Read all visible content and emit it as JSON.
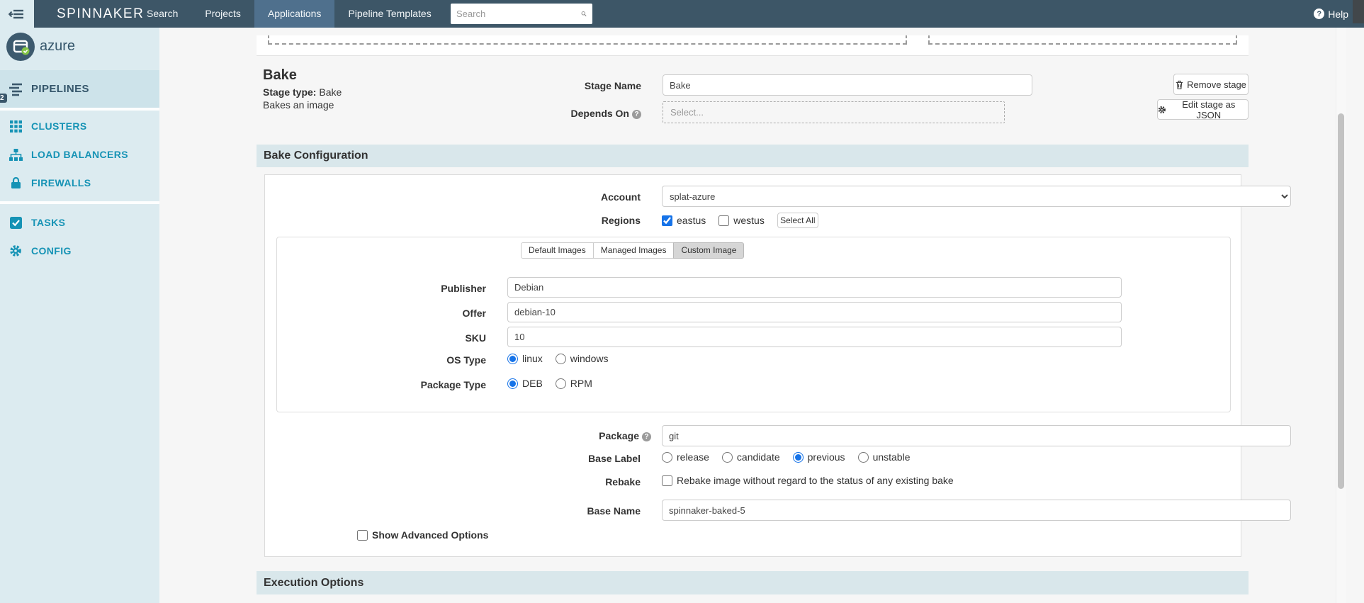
{
  "navbar": {
    "logo": "SPINNAKER",
    "search_item": "Search",
    "projects_item": "Projects",
    "applications_item": "Applications",
    "pipeline_templates_item": "Pipeline Templates",
    "search_placeholder": "Search",
    "help_label": "Help"
  },
  "icons": {
    "question_mark": "?"
  },
  "sidebar": {
    "app_name": "azure",
    "pipelines_label": "PIPELINES",
    "pipelines_badge": "2",
    "clusters_label": "CLUSTERS",
    "load_balancers_label": "LOAD BALANCERS",
    "firewalls_label": "FIREWALLS",
    "tasks_label": "TASKS",
    "config_label": "CONFIG"
  },
  "stage": {
    "title": "Bake",
    "type_label": "Stage type:",
    "type_value": "Bake",
    "description": "Bakes an image",
    "name_label": "Stage Name",
    "name_value": "Bake",
    "depends_label": "Depends On",
    "depends_placeholder": "Select...",
    "remove_label": "Remove stage",
    "edit_json_label": "Edit stage as JSON"
  },
  "bake": {
    "section_title": "Bake Configuration",
    "account_label": "Account",
    "account_value": "splat-azure",
    "regions_label": "Regions",
    "region_options": [
      {
        "label": "eastus",
        "checked": true
      },
      {
        "label": "westus",
        "checked": false
      }
    ],
    "select_all_label": "Select All",
    "image_tabs": [
      {
        "label": "Default Images",
        "active": false
      },
      {
        "label": "Managed Images",
        "active": false
      },
      {
        "label": "Custom Image",
        "active": true
      }
    ],
    "publisher_label": "Publisher",
    "publisher_value": "Debian",
    "offer_label": "Offer",
    "offer_value": "debian-10",
    "sku_label": "SKU",
    "sku_value": "10",
    "os_type_label": "OS Type",
    "os_options": [
      {
        "label": "linux",
        "selected": true
      },
      {
        "label": "windows",
        "selected": false
      }
    ],
    "package_type_label": "Package Type",
    "package_type_options": [
      {
        "label": "DEB",
        "selected": true
      },
      {
        "label": "RPM",
        "selected": false
      }
    ],
    "package_label": "Package",
    "package_value": "git",
    "base_label_label": "Base Label",
    "base_label_options": [
      {
        "label": "release",
        "selected": false
      },
      {
        "label": "candidate",
        "selected": false
      },
      {
        "label": "previous",
        "selected": true
      },
      {
        "label": "unstable",
        "selected": false
      }
    ],
    "rebake_label": "Rebake",
    "rebake_text": "Rebake image without regard to the status of any existing bake",
    "rebake_checked": false,
    "base_name_label": "Base Name",
    "base_name_value": "spinnaker-baked-5",
    "show_advanced_label": "Show Advanced Options",
    "show_advanced_checked": false
  },
  "execution": {
    "section_title": "Execution Options"
  },
  "colors": {
    "navbar": "#3d5667",
    "navbar_active_tab": "#4f708d",
    "sidebar_bg": "#dcebf0",
    "sidebar_selected": "#cde3ea",
    "accent_teal": "#1693b5",
    "dark_navy": "#35566b",
    "section_band": "#d9e7eb",
    "check_blue": "#1673e8"
  }
}
